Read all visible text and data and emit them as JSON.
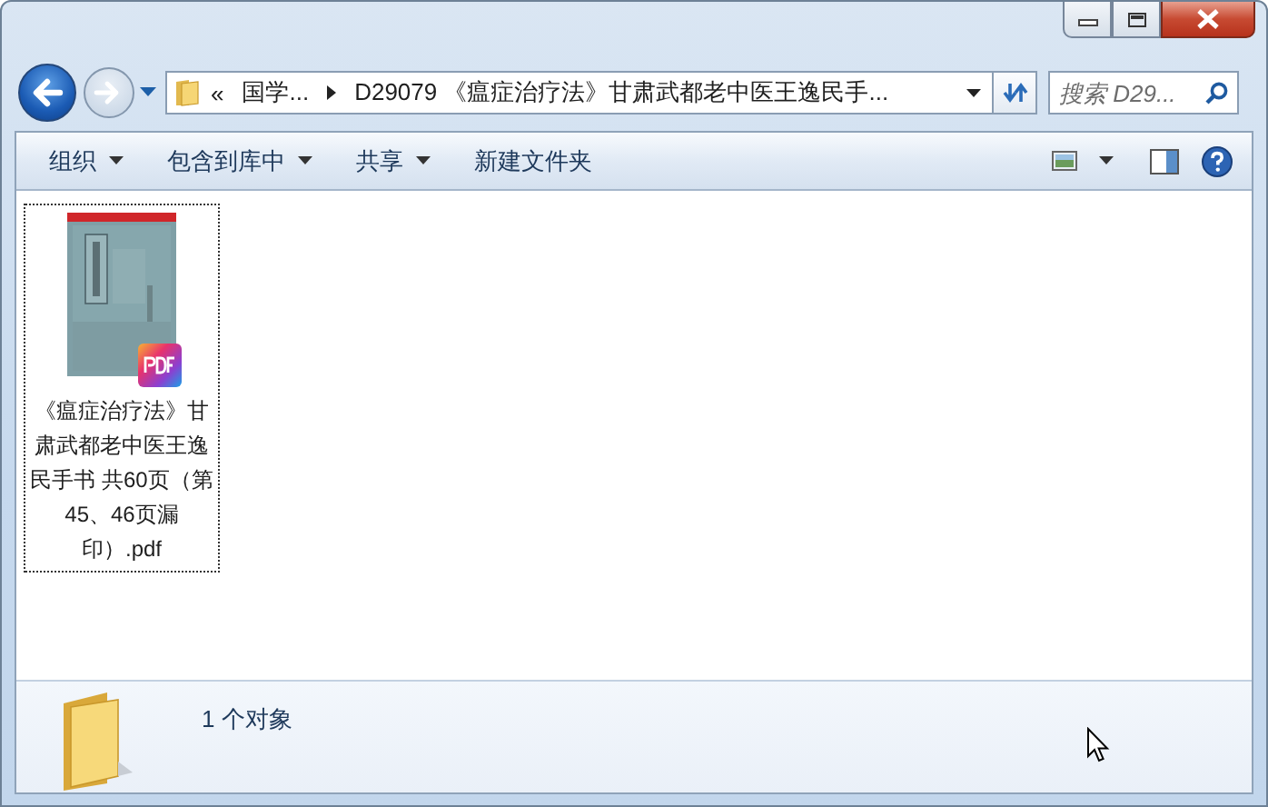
{
  "address_bar": {
    "crumbs": [
      {
        "kind": "overflow",
        "label": "«"
      },
      {
        "kind": "crumb",
        "label": "国学..."
      },
      {
        "kind": "crumb",
        "label": "D29079 《瘟症治疗法》甘肃武都老中医王逸民手..."
      }
    ]
  },
  "search": {
    "placeholder": "搜索 D29..."
  },
  "toolbar": {
    "items": [
      {
        "label": "组织",
        "has_menu": true
      },
      {
        "label": "包含到库中",
        "has_menu": true
      },
      {
        "label": "共享",
        "has_menu": true
      },
      {
        "label": "新建文件夹",
        "has_menu": false
      }
    ]
  },
  "files": [
    {
      "name": "《瘟症治疗法》甘肃武都老中医王逸民手书 共60页（第45、46页漏印）.pdf",
      "focused": true
    }
  ],
  "status_bar": {
    "text": "1 个对象"
  }
}
